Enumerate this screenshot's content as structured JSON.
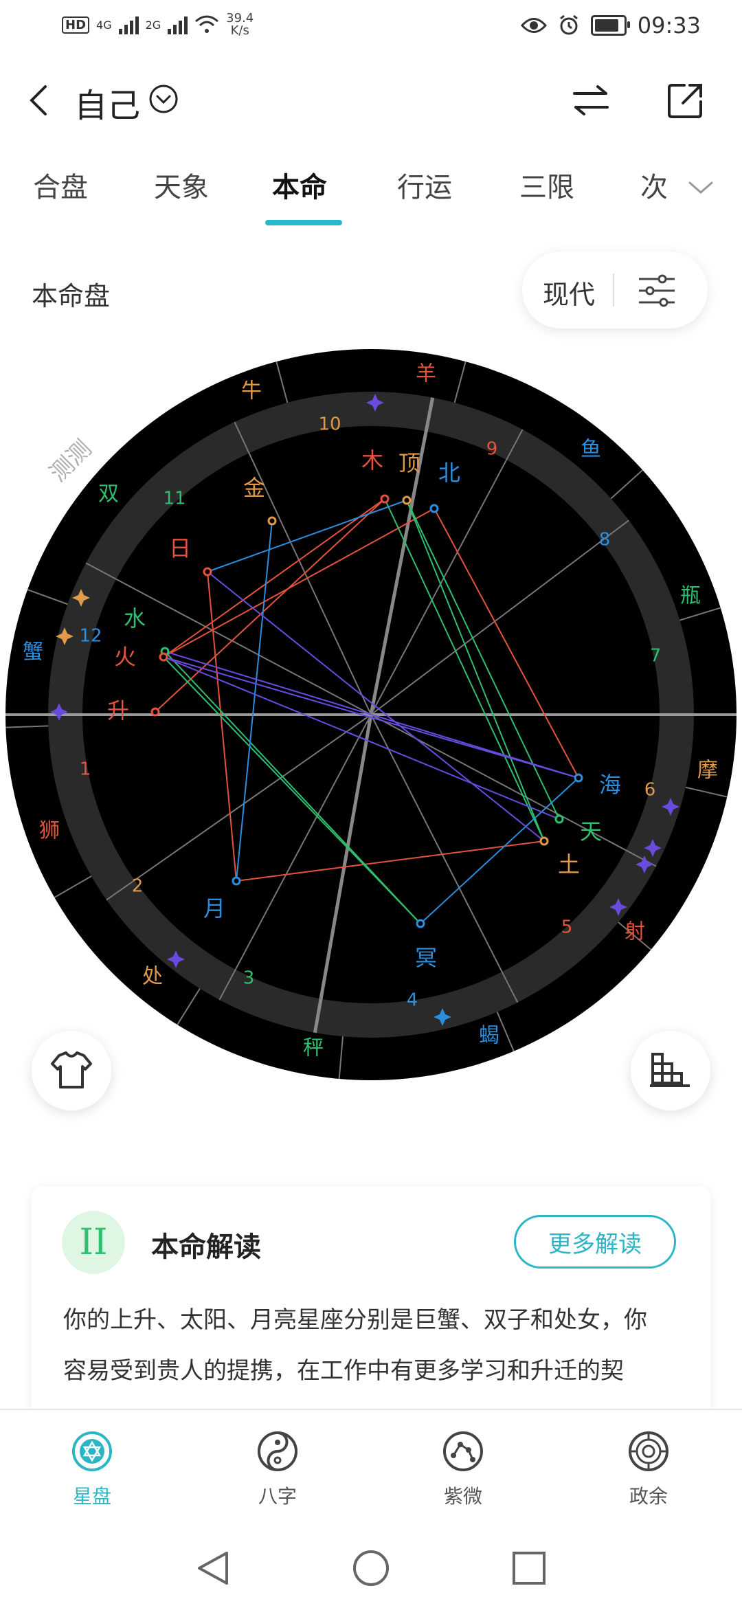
{
  "status_bar": {
    "hd": "HD",
    "signal_1": "4G",
    "signal_2": "2G",
    "speed_value": "39.4",
    "speed_unit": "K/s",
    "time": "09:33"
  },
  "top_bar": {
    "title": "自己"
  },
  "tabs": [
    {
      "label": "合盘",
      "active": false
    },
    {
      "label": "天象",
      "active": false
    },
    {
      "label": "本命",
      "active": true
    },
    {
      "label": "行运",
      "active": false
    },
    {
      "label": "三限",
      "active": false
    },
    {
      "label": "次",
      "active": false
    }
  ],
  "section": {
    "title": "本命盘",
    "mode_label": "现代"
  },
  "chart": {
    "watermark": "测测",
    "signs": [
      {
        "label": "羊",
        "color": "#e5533d"
      },
      {
        "label": "鱼",
        "color": "#2b8fe0"
      },
      {
        "label": "瓶",
        "color": "#2fbf71"
      },
      {
        "label": "摩",
        "color": "#e09a4a"
      },
      {
        "label": "射",
        "color": "#e5533d"
      },
      {
        "label": "蝎",
        "color": "#2b8fe0"
      },
      {
        "label": "秤",
        "color": "#2fbf71"
      },
      {
        "label": "处",
        "color": "#e09a4a"
      },
      {
        "label": "狮",
        "color": "#e5533d"
      },
      {
        "label": "蟹",
        "color": "#2b8fe0"
      },
      {
        "label": "双",
        "color": "#2fbf71"
      },
      {
        "label": "牛",
        "color": "#e09a4a"
      }
    ],
    "houses": [
      {
        "label": "1",
        "color": "#e5533d"
      },
      {
        "label": "2",
        "color": "#e09a4a"
      },
      {
        "label": "3",
        "color": "#2fbf71"
      },
      {
        "label": "4",
        "color": "#2b8fe0"
      },
      {
        "label": "5",
        "color": "#e5533d"
      },
      {
        "label": "6",
        "color": "#e09a4a"
      },
      {
        "label": "7",
        "color": "#2fbf71"
      },
      {
        "label": "8",
        "color": "#2b8fe0"
      },
      {
        "label": "9",
        "color": "#e5533d"
      },
      {
        "label": "10",
        "color": "#e09a4a"
      },
      {
        "label": "11",
        "color": "#2fbf71"
      },
      {
        "label": "12",
        "color": "#2b8fe0"
      }
    ],
    "planets": [
      {
        "label": "木",
        "color": "#e5533d"
      },
      {
        "label": "顶",
        "color": "#e09a4a"
      },
      {
        "label": "北",
        "color": "#2b8fe0"
      },
      {
        "label": "金",
        "color": "#e09a4a"
      },
      {
        "label": "日",
        "color": "#e5533d"
      },
      {
        "label": "水",
        "color": "#2fbf71"
      },
      {
        "label": "火",
        "color": "#e5533d"
      },
      {
        "label": "升",
        "color": "#e5533d"
      },
      {
        "label": "海",
        "color": "#2b8fe0"
      },
      {
        "label": "天",
        "color": "#2fbf71"
      },
      {
        "label": "土",
        "color": "#e09a4a"
      },
      {
        "label": "冥",
        "color": "#2b8fe0"
      },
      {
        "label": "月",
        "color": "#2b8fe0"
      }
    ]
  },
  "interpretation": {
    "title": "本命解读",
    "icon_glyph": "II",
    "more_button": "更多解读",
    "text_line1": "你的上升、太阳、月亮星座分别是巨蟹、双子和处女，你",
    "text_line2": "容易受到贵人的提携，在工作中有更多学习和升迁的契"
  },
  "bottom_nav": [
    {
      "label": "星盘",
      "icon": "star-chart-icon",
      "active": true
    },
    {
      "label": "八字",
      "icon": "yin-yang-icon",
      "active": false
    },
    {
      "label": "紫微",
      "icon": "constellation-icon",
      "active": false
    },
    {
      "label": "政余",
      "icon": "target-icon",
      "active": false
    }
  ],
  "colors": {
    "accent": "#27b8c9",
    "red": "#e5533d",
    "orange": "#e09a4a",
    "green": "#2fbf71",
    "blue": "#2b8fe0",
    "purple": "#6a4be0"
  }
}
